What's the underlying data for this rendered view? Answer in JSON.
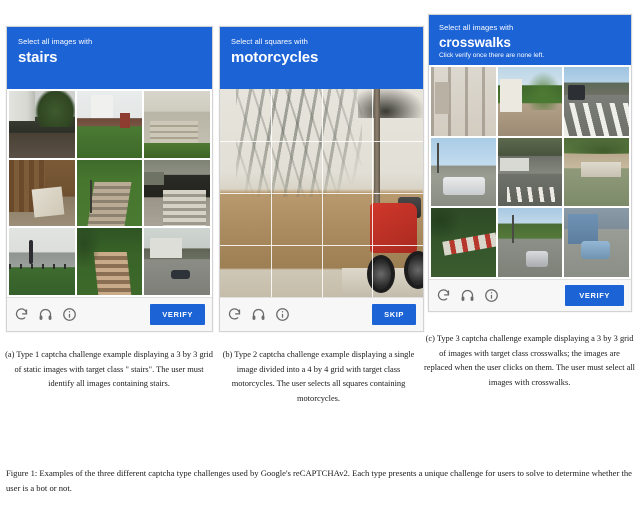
{
  "figure": {
    "caption": "Figure 1: Examples of the three different captcha type challenges used by Google's reCAPTCHAv2. Each type presents a unique challenge for users to solve to determine whether the user is a bot or not."
  },
  "theme": {
    "accent_blue": "#1c63d6",
    "card_background": "#f9f9f9",
    "footer_background": "#f7f7f7",
    "page_background": "#ffffff",
    "text_color": "#1a1a1a",
    "icon_color": "#6a6a6a"
  },
  "panels": [
    {
      "id": "panel-a",
      "header": {
        "prompt": "Select all images with",
        "target": "stairs",
        "hint": ""
      },
      "grid": {
        "type": "3x3-static-images",
        "rows": 3,
        "cols": 3
      },
      "tiles": [
        "apartment building with tree and dark car",
        "white houses with green lawn and red shed",
        "stone front steps with porch chair",
        "wooden fence with stacked debris",
        "stairway with handrail in grass",
        "concrete stairs beside dark doorway",
        "person walking on sidewalk by railing",
        "long stairway through trees",
        "street with parked cars and houses"
      ],
      "footer": {
        "icons": [
          "refresh-icon",
          "audio-icon",
          "info-icon"
        ],
        "action_label": "VERIFY"
      },
      "subcaption": {
        "label": "(a)",
        "text": "Type 1 captcha challenge example displaying a 3 by 3 grid of static images with target class \" stairs\". The user must identify all images containing stairs."
      }
    },
    {
      "id": "panel-b",
      "header": {
        "prompt": "Select all squares with",
        "target": "motorcycles",
        "hint": ""
      },
      "grid": {
        "type": "4x4-single-image-overlay",
        "rows": 4,
        "cols": 4
      },
      "tiles": [
        "single photo of a wall with tree shadows, a dirt slope and a red motorcycle"
      ],
      "footer": {
        "icons": [
          "refresh-icon",
          "audio-icon",
          "info-icon"
        ],
        "action_label": "SKIP"
      },
      "subcaption": {
        "label": "(b)",
        "text": "Type 2 captcha challenge example displaying a single image divided into a 4 by 4 grid with target class motorcycles. The user selects all squares containing motorcycles."
      }
    },
    {
      "id": "panel-c",
      "header": {
        "prompt": "Select all images with",
        "target": "crosswalks",
        "hint": "Click verify once there are none left."
      },
      "grid": {
        "type": "3x3-dynamic-images",
        "rows": 3,
        "cols": 3
      },
      "tiles": [
        "stone building facade with shutters",
        "white house with trees and driveway",
        "street crosswalk with car and pedestrian",
        "parking lot with traffic signals and SUV",
        "city street with zebra crossing",
        "suburban road with sidewalk and shrubs",
        "red and white barrier among green trees",
        "road with grey van and traffic pole",
        "blue car parked by a building"
      ],
      "footer": {
        "icons": [
          "refresh-icon",
          "audio-icon",
          "info-icon"
        ],
        "action_label": "VERIFY"
      },
      "subcaption": {
        "label": "(c)",
        "text": "Type 3 captcha challenge example displaying a 3 by 3 grid of images with target class crosswalks; the images are replaced when the user clicks on them. The user must select all images with crosswalks."
      }
    }
  ]
}
